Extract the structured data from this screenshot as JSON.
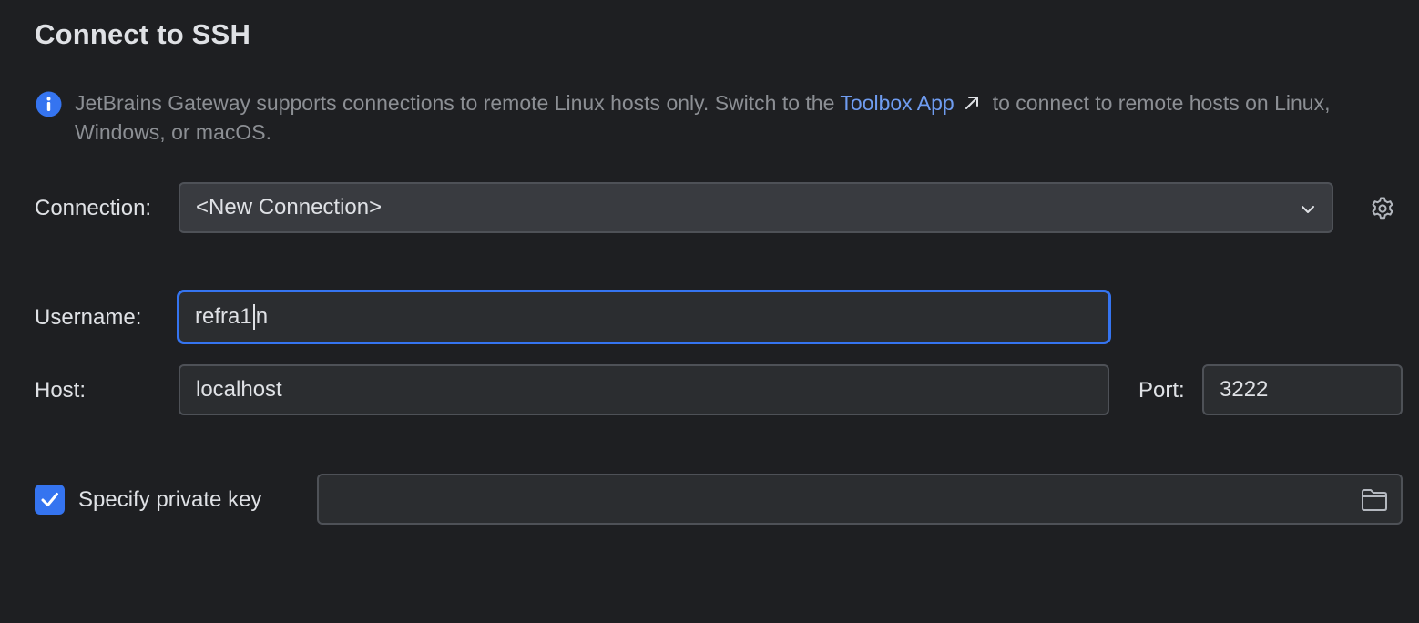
{
  "header": {
    "title": "Connect to SSH"
  },
  "notice": {
    "icon": "info-icon",
    "text_before": "JetBrains Gateway supports connections to remote Linux hosts only. Switch to the",
    "link_label": "Toolbox App",
    "text_after": "to connect to remote hosts on Linux, Windows, or macOS.",
    "link_color": "#6f9cf0"
  },
  "connection": {
    "label": "Connection:",
    "selected": "<New Connection>",
    "settings_icon": "gear-icon"
  },
  "username": {
    "label": "Username:",
    "value_before_caret": "refra1",
    "value_after_caret": "n"
  },
  "host": {
    "label": "Host:",
    "value": "localhost"
  },
  "port": {
    "label": "Port:",
    "value": "3222"
  },
  "private_key": {
    "checkbox_label": "Specify private key",
    "checked": true,
    "path": "",
    "browse_icon": "folder-icon"
  },
  "colors": {
    "background": "#1e1f22",
    "accent": "#3574f0",
    "field_bg": "#2b2d30",
    "field_border": "#4e5157"
  }
}
